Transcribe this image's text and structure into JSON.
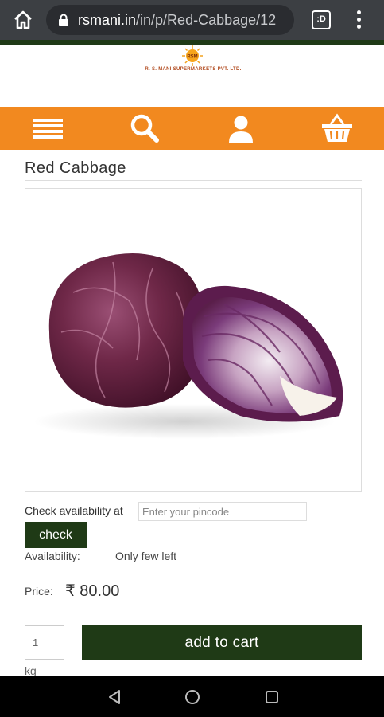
{
  "browser": {
    "url_host": "rsmani.in",
    "url_path": "/in/p/Red-Cabbage/12",
    "tab_count_label": ":D",
    "home_icon": "home-icon",
    "lock_icon": "lock-icon",
    "menu_icon": "more-vert-icon"
  },
  "header": {
    "logo_text": "R. S. MANI SUPERMARKETS PVT. LTD.",
    "logo_badge": "RSM",
    "nav": [
      {
        "icon": "menu-icon"
      },
      {
        "icon": "search-icon"
      },
      {
        "icon": "user-icon"
      },
      {
        "icon": "basket-icon"
      }
    ]
  },
  "product": {
    "title": "Red Cabbage",
    "image": "red-cabbage-image",
    "check_label": "Check availability at",
    "pincode_placeholder": "Enter your pincode",
    "check_button": "check",
    "availability_label": "Availability:",
    "availability_value": "Only few left",
    "price_label": "Price:",
    "price_value": "₹ 80.00",
    "quantity_value": "1",
    "add_to_cart": "add to cart",
    "unit": "kg"
  },
  "colors": {
    "nav_orange": "#f2891f",
    "button_green": "#1f3a16",
    "browser_bar": "#3c3f43"
  }
}
